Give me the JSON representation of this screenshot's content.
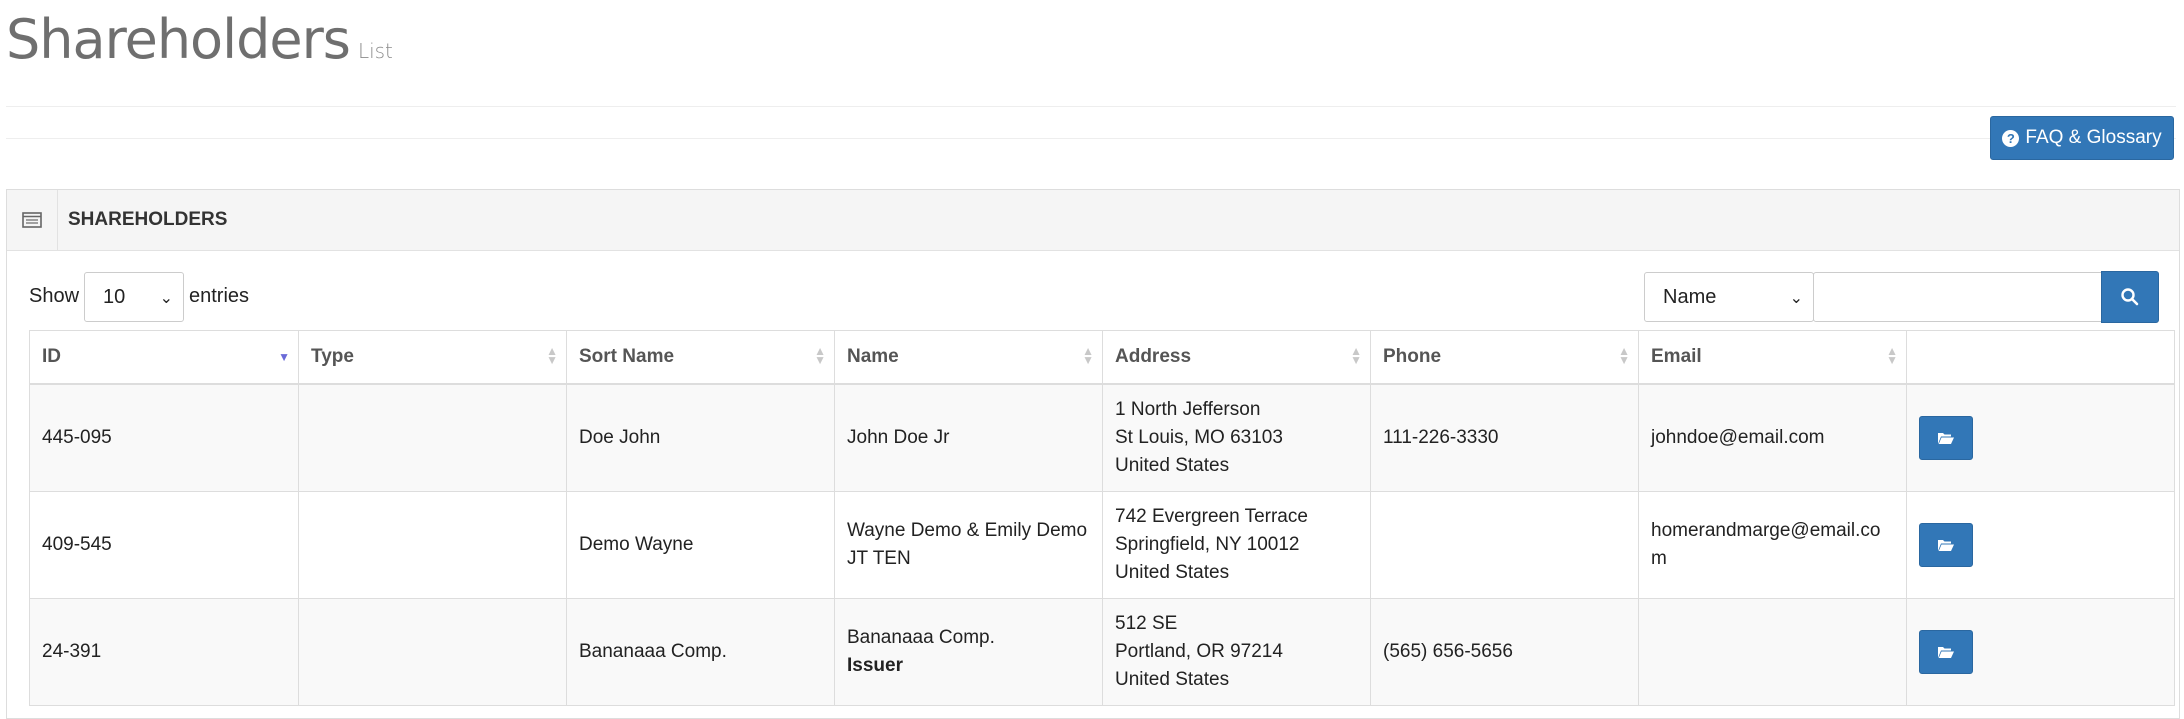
{
  "page": {
    "title": "Shareholders",
    "subtitle": "List"
  },
  "faq_button": {
    "label": "FAQ & Glossary",
    "icon": "question-circle-icon"
  },
  "panel": {
    "title": "SHAREHOLDERS",
    "icon": "list-icon"
  },
  "controls": {
    "show_label": "Show",
    "page_length": "10",
    "entries_label": "entries",
    "search_field": "Name",
    "search_value": "",
    "search_icon": "search-icon"
  },
  "table": {
    "columns": [
      "ID",
      "Type",
      "Sort Name",
      "Name",
      "Address",
      "Phone",
      "Email",
      ""
    ],
    "sorted_column": "ID",
    "sort_direction": "desc",
    "rows": [
      {
        "id": "445-095",
        "type": "",
        "sort_name": "Doe John",
        "name": "John Doe Jr",
        "name_role": "",
        "address": [
          "1 North Jefferson",
          "St Louis, MO 63103",
          "United States"
        ],
        "phone": "111-226-3330",
        "email": "johndoe@email.com"
      },
      {
        "id": "409-545",
        "type": "",
        "sort_name": "Demo Wayne",
        "name": "Wayne Demo & Emily Demo JT TEN",
        "name_role": "",
        "address": [
          "742 Evergreen Terrace",
          "Springfield, NY 10012",
          "United States"
        ],
        "phone": "",
        "email": "homerandmarge@email.com"
      },
      {
        "id": "24-391",
        "type": "",
        "sort_name": "Bananaaa Comp.",
        "name": "Bananaaa Comp.",
        "name_role": "Issuer",
        "address": [
          "512 SE",
          "Portland, OR 97214",
          "United States"
        ],
        "phone": "(565) 656-5656",
        "email": ""
      }
    ],
    "row_action_icon": "folder-open-icon"
  },
  "colors": {
    "primary": "#3277b7",
    "title_text": "#6f6f6f",
    "border": "#dddddd",
    "panel_header_bg": "#f5f5f5",
    "row_stripe": "#f9f9f9"
  }
}
